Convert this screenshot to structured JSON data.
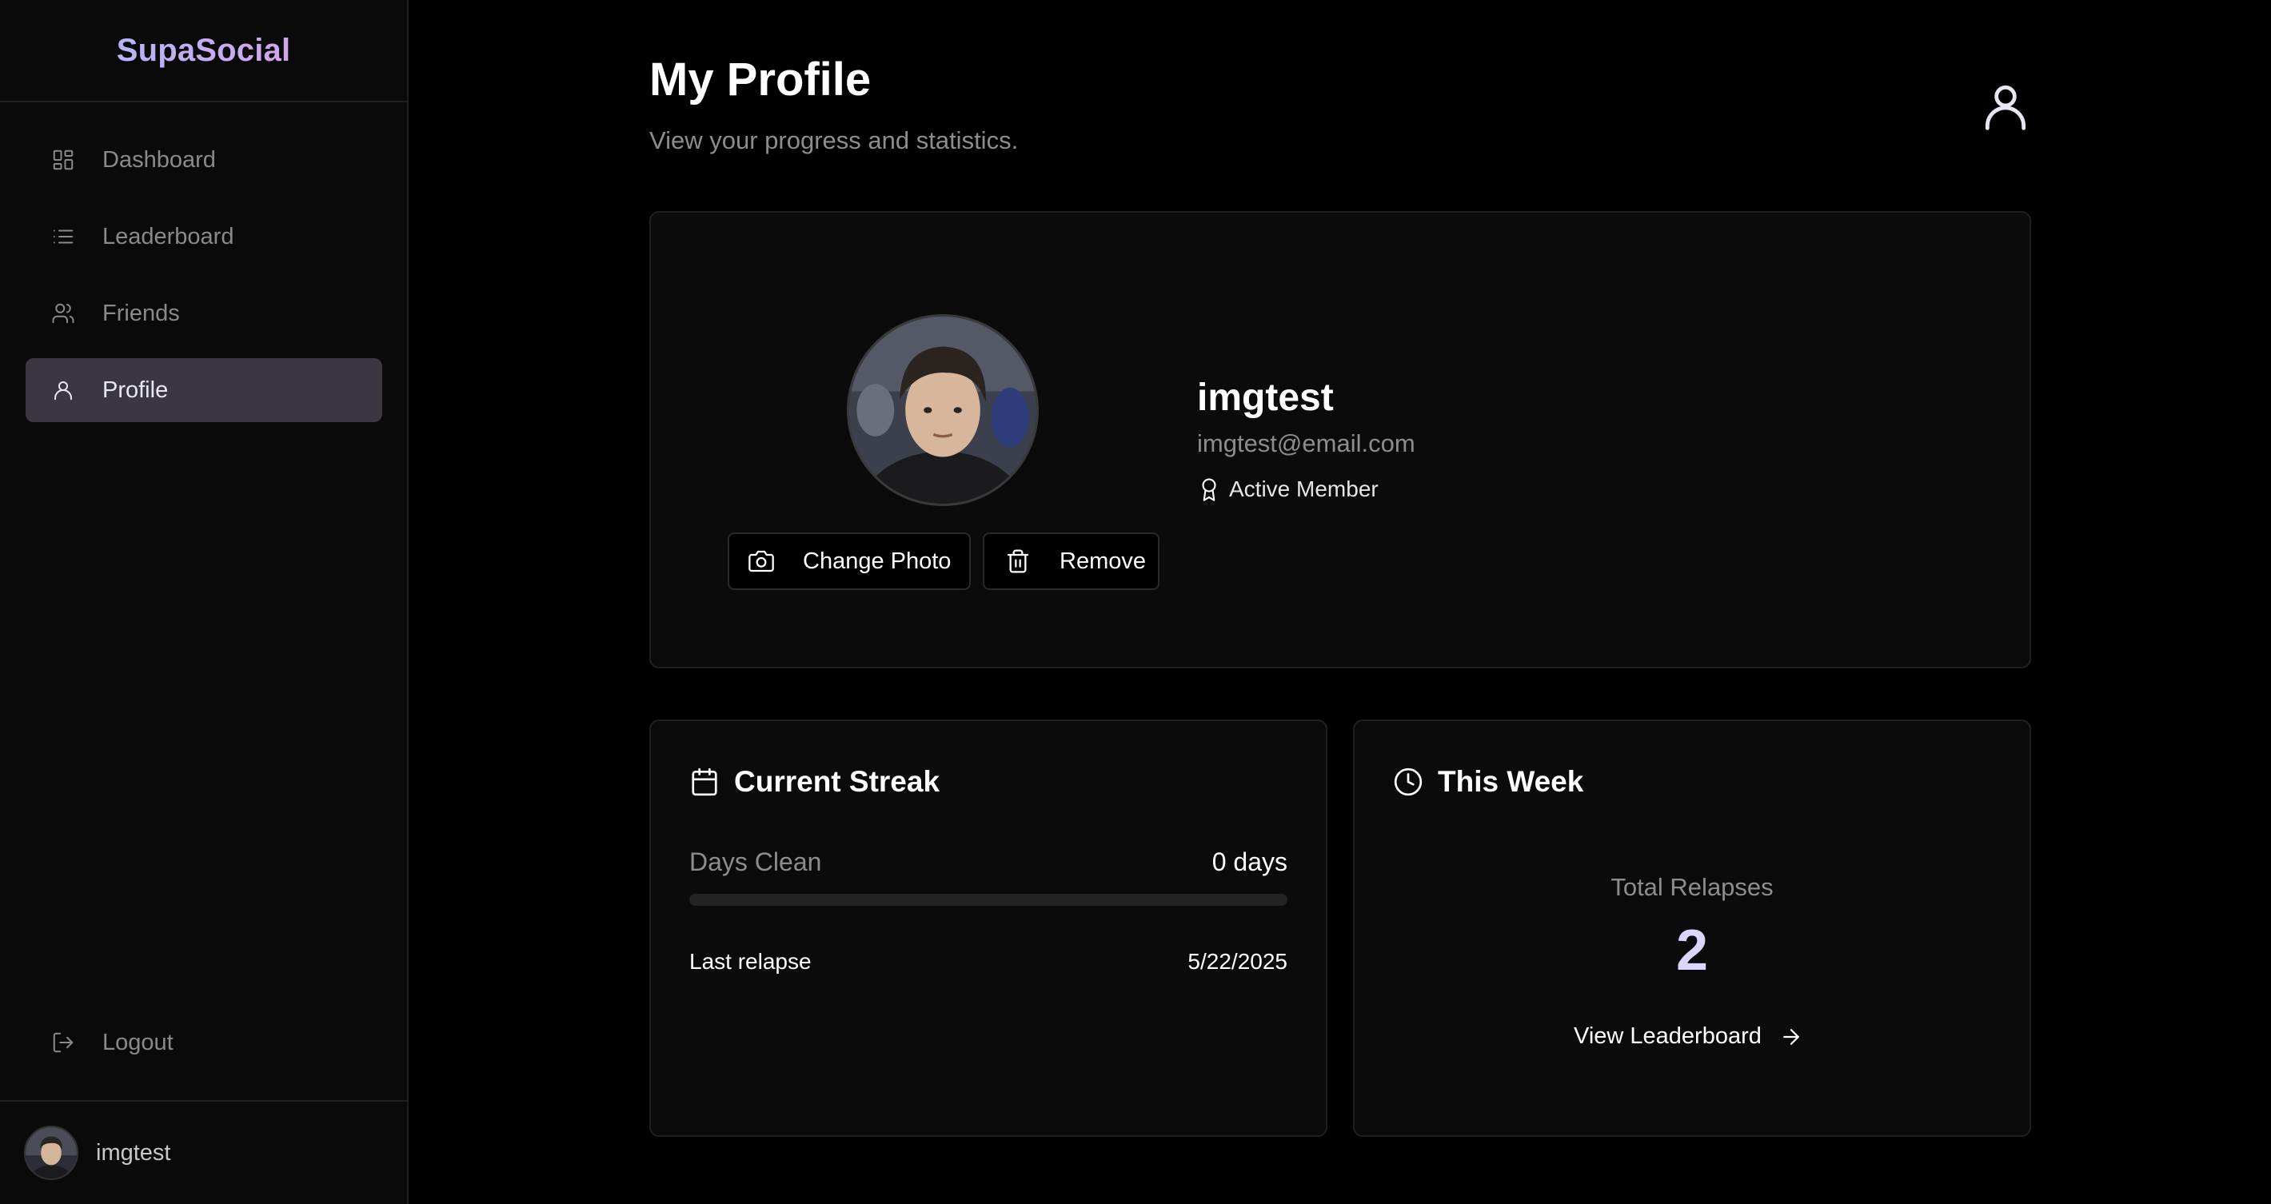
{
  "brand": {
    "name": "SupaSocial",
    "gradient": [
      "#b7b5f4",
      "#cfa6ea"
    ]
  },
  "sidebar": {
    "items": [
      {
        "label": "Dashboard",
        "icon": "dashboard-grid-icon",
        "active": false
      },
      {
        "label": "Leaderboard",
        "icon": "list-icon",
        "active": false
      },
      {
        "label": "Friends",
        "icon": "users-icon",
        "active": false
      },
      {
        "label": "Profile",
        "icon": "user-icon",
        "active": true
      }
    ],
    "logout_label": "Logout",
    "logout_icon": "logout-icon",
    "username": "imgtest"
  },
  "header": {
    "title": "My Profile",
    "subtitle": "View your progress and statistics.",
    "user_icon": "user-icon"
  },
  "profile": {
    "username": "imgtest",
    "email": "imgtest@email.com",
    "badge": "Active Member",
    "badge_icon": "award-icon",
    "change_photo_label": "Change Photo",
    "change_photo_icon": "camera-icon",
    "remove_label": "Remove",
    "remove_icon": "trash-icon"
  },
  "streak": {
    "title": "Current Streak",
    "icon": "calendar-icon",
    "days_label": "Days Clean",
    "days_value": "0 days",
    "progress_percent": 0,
    "last_relapse_label": "Last relapse",
    "last_relapse_date": "5/22/2025"
  },
  "week": {
    "title": "This Week",
    "icon": "clock-icon",
    "total_label": "Total Relapses",
    "total_value": "2",
    "link_label": "View Leaderboard",
    "link_icon": "arrow-right-icon"
  },
  "colors": {
    "accent": "#ddd4ff",
    "active_nav_bg": "#3a3742",
    "card_bg": "#0b0b0b",
    "muted_text": "#8d8d8d"
  }
}
